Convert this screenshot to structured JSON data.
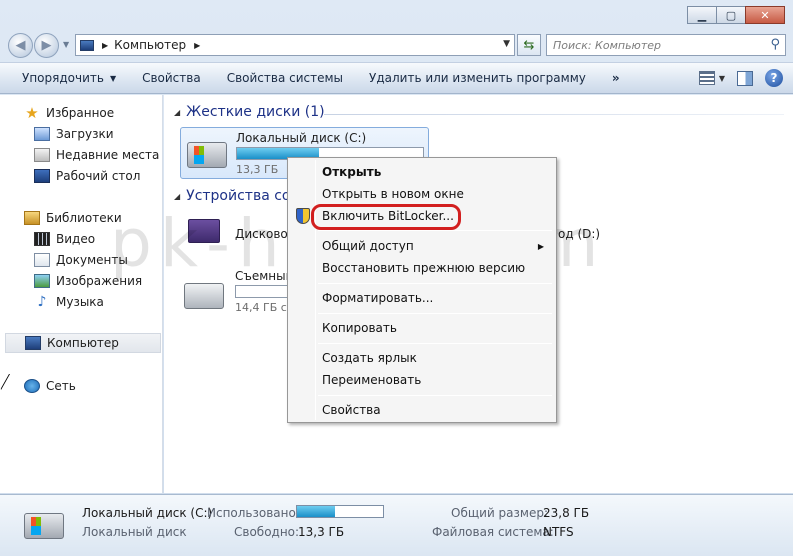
{
  "address": {
    "crumb": "Компьютер",
    "search_placeholder": "Поиск: Компьютер"
  },
  "toolbar": {
    "organize": "Упорядочить",
    "properties": "Свойства",
    "system_properties": "Свойства системы",
    "uninstall": "Удалить или изменить программу",
    "more": "»"
  },
  "nav": {
    "favorites": "Избранное",
    "downloads": "Загрузки",
    "recent": "Недавние места",
    "desktop": "Рабочий стол",
    "libraries": "Библиотеки",
    "video": "Видео",
    "documents": "Документы",
    "images": "Изображения",
    "music": "Музыка",
    "computer": "Компьютер",
    "network": "Сеть"
  },
  "groups": {
    "hard_drives": "Жесткие диски (1)",
    "devices": "Устройства со"
  },
  "drives": {
    "c": {
      "name": "Локальный диск (C:)",
      "free": "13,3 ГБ",
      "used_fraction": 0.44
    },
    "dvd": {
      "name": "Дисковод",
      "name_tail": "од (D:)"
    },
    "removable": {
      "name": "Съемный",
      "free": "14,4 ГБ св",
      "used_fraction": 0.0
    }
  },
  "menu": {
    "open": "Открыть",
    "open_new_window": "Открыть в новом окне",
    "bitlocker": "Включить BitLocker...",
    "sharing": "Общий доступ",
    "restore": "Восстановить прежнюю версию",
    "format": "Форматировать...",
    "copy": "Копировать",
    "shortcut": "Создать ярлык",
    "rename": "Переименовать",
    "properties": "Свойства"
  },
  "details": {
    "name": "Локальный диск (C:)",
    "type": "Локальный диск",
    "used_label": "Использовано:",
    "used_fraction": 0.44,
    "free_label": "Свободно:",
    "free_value": "13,3 ГБ",
    "total_label": "Общий размер:",
    "total_value": "23,8 ГБ",
    "fs_label": "Файловая система:",
    "fs_value": "NTFS"
  },
  "watermark": "pk-help.com",
  "colors": {
    "highlight_ring": "#d21f1f",
    "bar_fill": "#1a8fc8",
    "group_heading": "#1e3287"
  }
}
